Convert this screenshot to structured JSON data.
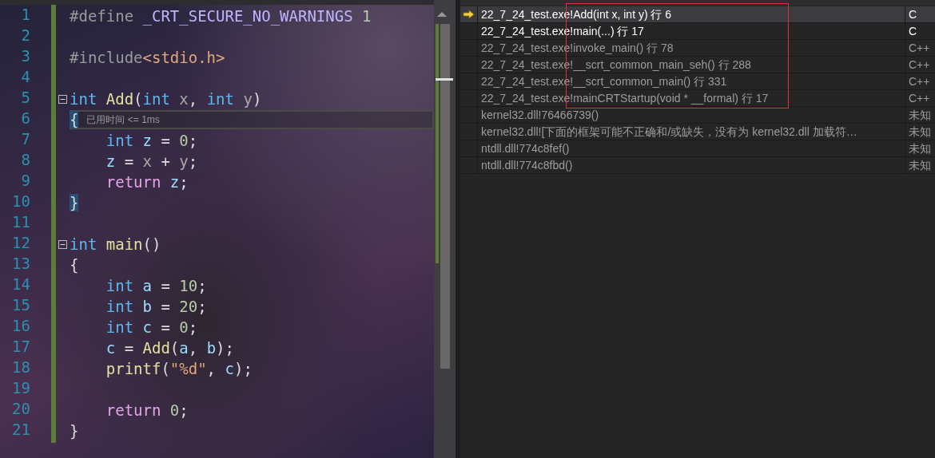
{
  "editor": {
    "lines": [
      {
        "number": "1",
        "fold_marker": false,
        "tokens": [
          {
            "kind": "preproc",
            "text": "#define"
          },
          {
            "kind": "macro",
            "text": " _CRT_SECURE_NO_WARNINGS"
          },
          {
            "kind": "number",
            "text": " 1"
          }
        ]
      },
      {
        "number": "2",
        "fold_marker": false
      },
      {
        "number": "3",
        "fold_marker": false,
        "tokens": [
          {
            "kind": "preproc",
            "text": "#include"
          },
          {
            "kind": "string",
            "text": "<stdio.h>"
          }
        ]
      },
      {
        "number": "4",
        "fold_marker": false
      },
      {
        "number": "5",
        "fold_marker": true,
        "tokens": [
          {
            "kind": "keyword",
            "text": "int"
          },
          {
            "kind": "function",
            "text": " Add"
          },
          {
            "kind": "plain",
            "text": "("
          },
          {
            "kind": "keyword",
            "text": "int"
          },
          {
            "kind": "param",
            "text": " x"
          },
          {
            "kind": "plain",
            "text": ", "
          },
          {
            "kind": "keyword",
            "text": "int"
          },
          {
            "kind": "param",
            "text": " y"
          },
          {
            "kind": "plain",
            "text": ")"
          }
        ]
      },
      {
        "number": "6",
        "fold_marker": false,
        "tokens": [
          {
            "kind": "brace_match",
            "text": "{"
          }
        ],
        "hint": "已用时间 <= 1ms"
      },
      {
        "number": "7",
        "fold_marker": false,
        "tokens": [
          {
            "kind": "keyword",
            "text": "    int"
          },
          {
            "kind": "local",
            "text": " z"
          },
          {
            "kind": "plain",
            "text": " = "
          },
          {
            "kind": "number",
            "text": "0"
          },
          {
            "kind": "plain",
            "text": ";"
          }
        ]
      },
      {
        "number": "8",
        "fold_marker": false,
        "tokens": [
          {
            "kind": "local",
            "text": "    z"
          },
          {
            "kind": "plain",
            "text": " = "
          },
          {
            "kind": "param",
            "text": "x"
          },
          {
            "kind": "plain",
            "text": " + "
          },
          {
            "kind": "param",
            "text": "y"
          },
          {
            "kind": "plain",
            "text": ";"
          }
        ]
      },
      {
        "number": "9",
        "fold_marker": false,
        "tokens": [
          {
            "kind": "control",
            "text": "    return"
          },
          {
            "kind": "local",
            "text": " z"
          },
          {
            "kind": "plain",
            "text": ";"
          }
        ]
      },
      {
        "number": "10",
        "fold_marker": false,
        "tokens": [
          {
            "kind": "brace_match",
            "text": "}"
          }
        ]
      },
      {
        "number": "11",
        "fold_marker": false
      },
      {
        "number": "12",
        "fold_marker": true,
        "tokens": [
          {
            "kind": "keyword",
            "text": "int"
          },
          {
            "kind": "function",
            "text": " main"
          },
          {
            "kind": "plain",
            "text": "()"
          }
        ]
      },
      {
        "number": "13",
        "fold_marker": false,
        "tokens": [
          {
            "kind": "plain",
            "text": "{"
          }
        ]
      },
      {
        "number": "14",
        "fold_marker": false,
        "tokens": [
          {
            "kind": "keyword",
            "text": "    int"
          },
          {
            "kind": "local",
            "text": " a"
          },
          {
            "kind": "plain",
            "text": " = "
          },
          {
            "kind": "number",
            "text": "10"
          },
          {
            "kind": "plain",
            "text": ";"
          }
        ]
      },
      {
        "number": "15",
        "fold_marker": false,
        "tokens": [
          {
            "kind": "keyword",
            "text": "    int"
          },
          {
            "kind": "local",
            "text": " b"
          },
          {
            "kind": "plain",
            "text": " = "
          },
          {
            "kind": "number",
            "text": "20"
          },
          {
            "kind": "plain",
            "text": ";"
          }
        ]
      },
      {
        "number": "16",
        "fold_marker": false,
        "tokens": [
          {
            "kind": "keyword",
            "text": "    int"
          },
          {
            "kind": "local",
            "text": " c"
          },
          {
            "kind": "plain",
            "text": " = "
          },
          {
            "kind": "number",
            "text": "0"
          },
          {
            "kind": "plain",
            "text": ";"
          }
        ]
      },
      {
        "number": "17",
        "fold_marker": false,
        "tokens": [
          {
            "kind": "local",
            "text": "    c"
          },
          {
            "kind": "plain",
            "text": " = "
          },
          {
            "kind": "function",
            "text": "Add"
          },
          {
            "kind": "plain",
            "text": "("
          },
          {
            "kind": "local",
            "text": "a"
          },
          {
            "kind": "plain",
            "text": ", "
          },
          {
            "kind": "local",
            "text": "b"
          },
          {
            "kind": "plain",
            "text": ");"
          }
        ]
      },
      {
        "number": "18",
        "fold_marker": false,
        "tokens": [
          {
            "kind": "function",
            "text": "    printf"
          },
          {
            "kind": "plain",
            "text": "("
          },
          {
            "kind": "string",
            "text": "\"%d\""
          },
          {
            "kind": "plain",
            "text": ", "
          },
          {
            "kind": "local",
            "text": "c"
          },
          {
            "kind": "plain",
            "text": ");"
          }
        ]
      },
      {
        "number": "19",
        "fold_marker": false
      },
      {
        "number": "20",
        "fold_marker": false,
        "tokens": [
          {
            "kind": "control",
            "text": "    return"
          },
          {
            "kind": "number",
            "text": " 0"
          },
          {
            "kind": "plain",
            "text": ";"
          }
        ]
      },
      {
        "number": "21",
        "fold_marker": false,
        "tokens": [
          {
            "kind": "plain",
            "text": "}"
          }
        ]
      }
    ]
  },
  "call_stack": {
    "rows": [
      {
        "frame": "22_7_24_test.exe!Add(int x, int y) 行 6",
        "language": "C",
        "current": true,
        "user_code": true,
        "boxed": true
      },
      {
        "frame": "22_7_24_test.exe!main(...) 行 17",
        "language": "C",
        "current": false,
        "user_code": true,
        "boxed": true
      },
      {
        "frame": "22_7_24_test.exe!invoke_main() 行 78",
        "language": "C++",
        "current": false,
        "user_code": false,
        "boxed": true
      },
      {
        "frame": "22_7_24_test.exe!__scrt_common_main_seh() 行 288",
        "language": "C++",
        "current": false,
        "user_code": false,
        "boxed": true
      },
      {
        "frame": "22_7_24_test.exe!__scrt_common_main() 行 331",
        "language": "C++",
        "current": false,
        "user_code": false,
        "boxed": true
      },
      {
        "frame": "22_7_24_test.exe!mainCRTStartup(void * __formal) 行 17",
        "language": "C++",
        "current": false,
        "user_code": false,
        "boxed": true
      },
      {
        "frame": "kernel32.dll!76466739()",
        "language": "未知",
        "current": false,
        "user_code": false,
        "boxed": false
      },
      {
        "frame": "kernel32.dll![下面的框架可能不正确和/或缺失，没有为 kernel32.dll 加载符…",
        "language": "未知",
        "current": false,
        "user_code": false,
        "boxed": false
      },
      {
        "frame": "ntdll.dll!774c8fef()",
        "language": "未知",
        "current": false,
        "user_code": false,
        "boxed": false
      },
      {
        "frame": "ntdll.dll!774c8fbd()",
        "language": "未知",
        "current": false,
        "user_code": false,
        "boxed": false
      }
    ]
  }
}
